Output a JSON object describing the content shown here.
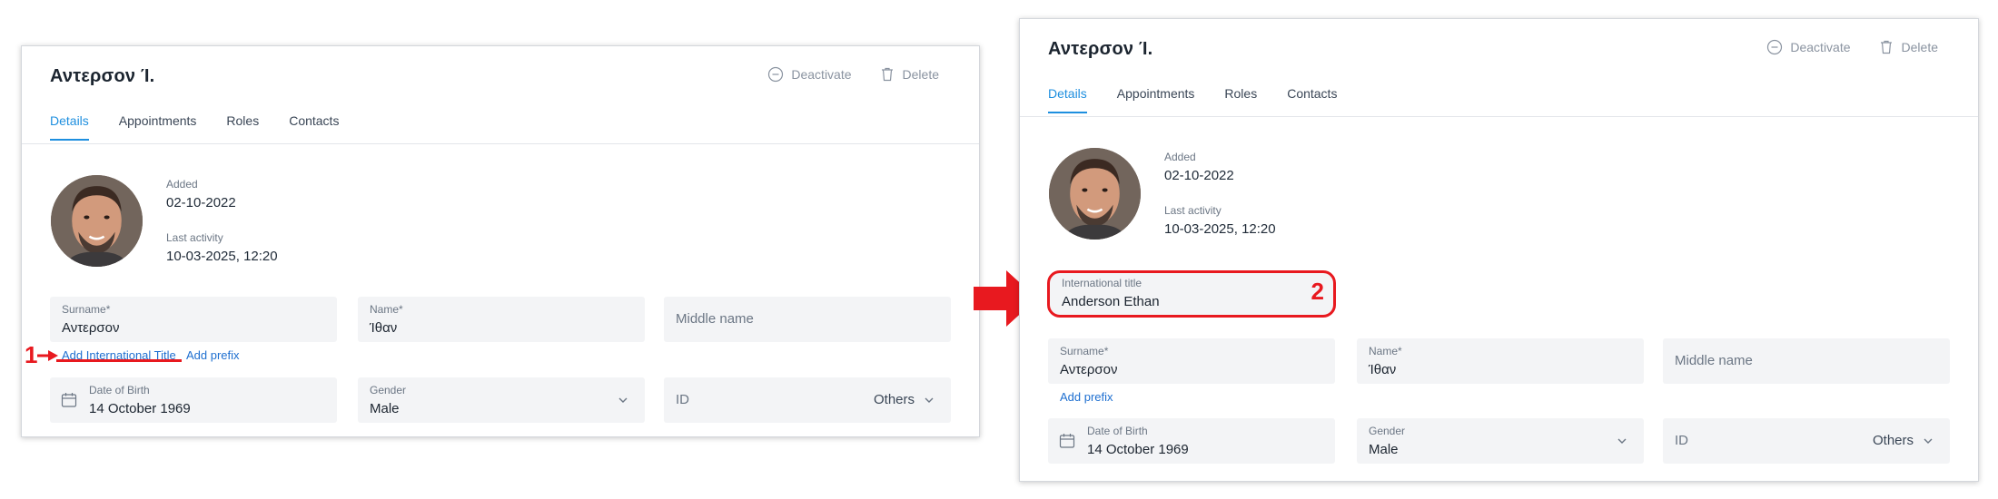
{
  "accent_color": "#1e8fdf",
  "annotation_color": "#e8191f",
  "screen1": {
    "title": "Αντερσον Ί.",
    "actions": {
      "deactivate": "Deactivate",
      "delete": "Delete"
    },
    "tabs": [
      "Details",
      "Appointments",
      "Roles",
      "Contacts"
    ],
    "added_label": "Added",
    "added_value": "02-10-2022",
    "last_activity_label": "Last activity",
    "last_activity_value": "10-03-2025, 12:20",
    "surname_label": "Surname*",
    "surname_value": "Αντερσον",
    "name_label": "Name*",
    "name_value": "Ίθαν",
    "middle_name_placeholder": "Middle name",
    "add_international_title": "Add International Title",
    "add_prefix": "Add prefix",
    "dob_label": "Date of Birth",
    "dob_value": "14 October 1969",
    "gender_label": "Gender",
    "gender_value": "Male",
    "id_label": "ID",
    "id_type": "Others",
    "step_number": "1"
  },
  "screen2": {
    "title": "Αντερσον Ί.",
    "actions": {
      "deactivate": "Deactivate",
      "delete": "Delete"
    },
    "tabs": [
      "Details",
      "Appointments",
      "Roles",
      "Contacts"
    ],
    "added_label": "Added",
    "added_value": "02-10-2022",
    "last_activity_label": "Last activity",
    "last_activity_value": "10-03-2025, 12:20",
    "international_title_label": "International title",
    "international_title_value": "Anderson Ethan",
    "surname_label": "Surname*",
    "surname_value": "Αντερσον",
    "name_label": "Name*",
    "name_value": "Ίθαν",
    "middle_name_placeholder": "Middle name",
    "add_prefix": "Add prefix",
    "dob_label": "Date of Birth",
    "dob_value": "14 October 1969",
    "gender_label": "Gender",
    "gender_value": "Male",
    "id_label": "ID",
    "id_type": "Others",
    "step_number": "2"
  }
}
